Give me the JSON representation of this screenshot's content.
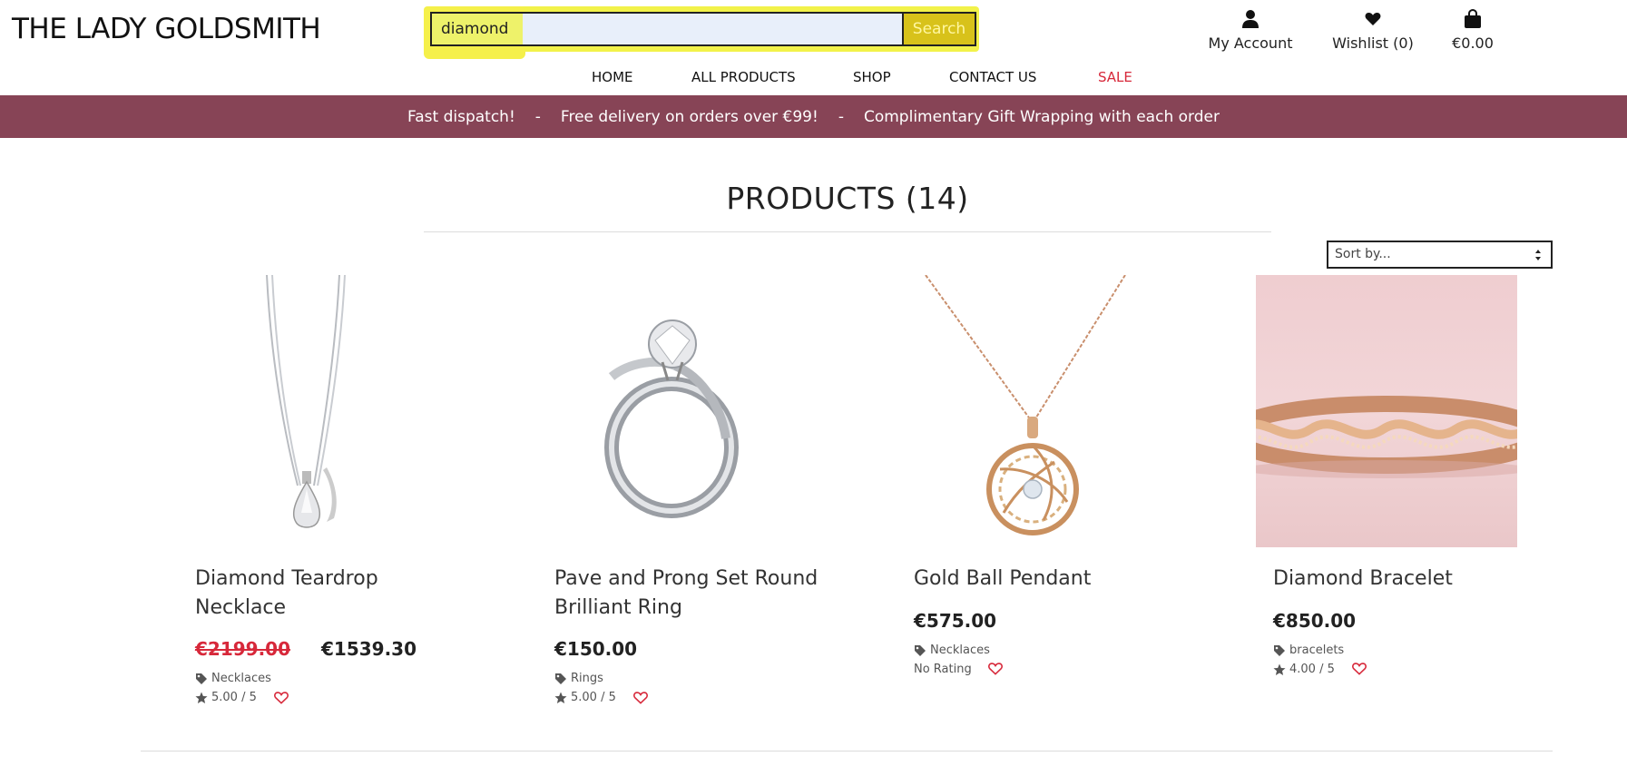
{
  "header": {
    "logo": "THE LADY GOLDSMITH",
    "search": {
      "value": "diamond",
      "button_label": "Search"
    },
    "account_label": "My Account",
    "wishlist_label": "Wishlist (0)",
    "cart_label": "€0.00"
  },
  "nav": {
    "items": [
      {
        "label": "HOME"
      },
      {
        "label": "ALL PRODUCTS"
      },
      {
        "label": "SHOP"
      },
      {
        "label": "CONTACT US"
      },
      {
        "label": "SALE"
      }
    ]
  },
  "banner": {
    "items": [
      "Fast dispatch!",
      "Free delivery on orders over €99!",
      "Complimentary Gift Wrapping with each order"
    ],
    "separator": "-"
  },
  "main": {
    "title": "PRODUCTS (14)",
    "sort_placeholder": "Sort by..."
  },
  "products": [
    {
      "name": "Diamond Teardrop Necklace",
      "old_price": "€2199.00",
      "price": "€1539.30",
      "category": "Necklaces",
      "rating": "5.00 / 5"
    },
    {
      "name": "Pave and Prong Set Round Brilliant Ring",
      "price": "€150.00",
      "category": "Rings",
      "rating": "5.00 / 5"
    },
    {
      "name": "Gold Ball Pendant",
      "price": "€575.00",
      "category": "Necklaces",
      "rating": "No Rating"
    },
    {
      "name": "Diamond Bracelet",
      "price": "€850.00",
      "category": "bracelets",
      "rating": "4.00 / 5"
    }
  ],
  "colors": {
    "banner_bg": "#874456",
    "sale": "#d7283a",
    "search_highlight": "#f2f24a",
    "heart": "#d7283a"
  }
}
